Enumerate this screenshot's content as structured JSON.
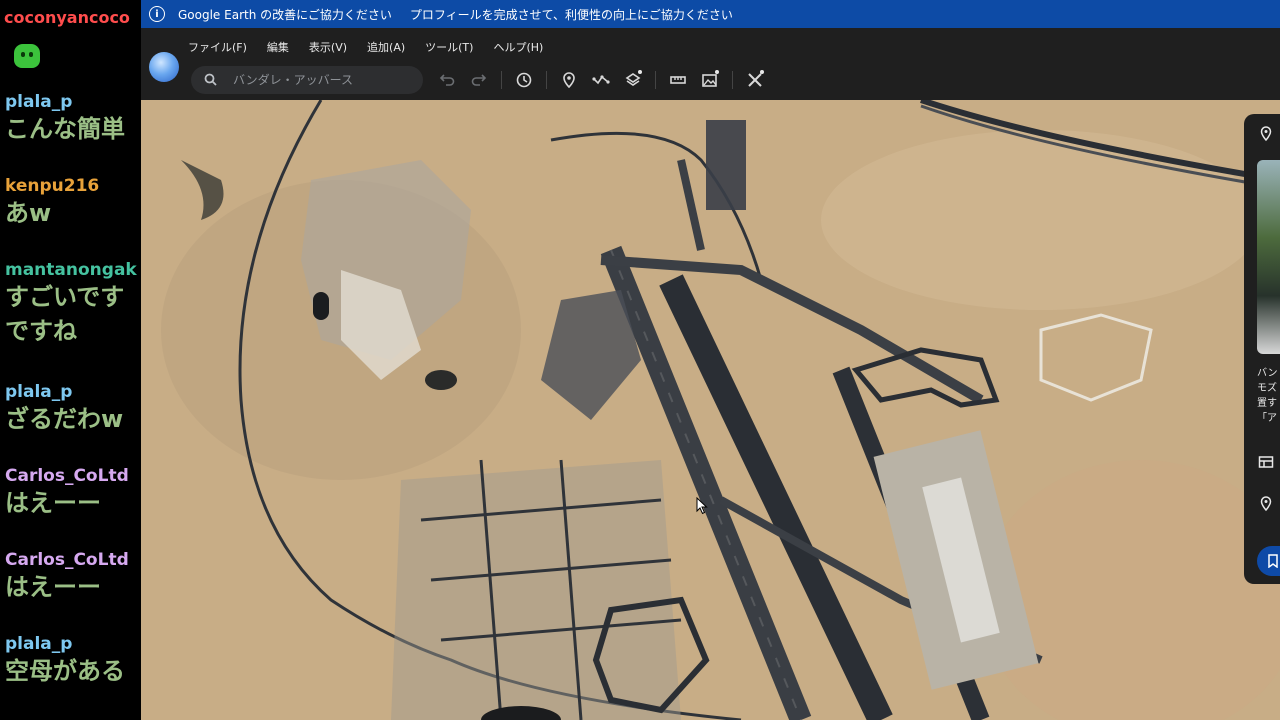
{
  "chat": {
    "top_user": "coconyancoco",
    "messages": [
      {
        "user": "plala_p",
        "text": "こんな簡単",
        "color": "#7ec8f0"
      },
      {
        "user": "kenpu216",
        "text": "あw",
        "color": "#e8a23a"
      },
      {
        "user": "mantanongak",
        "text": "すごいです",
        "text2": "ですね",
        "color": "#45c2a0"
      },
      {
        "user": "plala_p",
        "text": "ざるだわw",
        "color": "#7ec8f0"
      },
      {
        "user": "Carlos_CoLtd",
        "text": "はえーー",
        "color": "#d6a9f0"
      },
      {
        "user": "Carlos_CoLtd",
        "text": "はえーー",
        "color": "#d6a9f0"
      },
      {
        "user": "plala_p",
        "text": "空母がある",
        "color": "#7ec8f0"
      }
    ]
  },
  "banner": {
    "link1": "Google Earth の改善にご協力ください",
    "link2": "プロフィールを完成させて、利便性の向上にご協力ください"
  },
  "menu": [
    "ファイル(F)",
    "編集",
    "表示(V)",
    "追加(A)",
    "ツール(T)",
    "ヘルプ(H)"
  ],
  "search": {
    "placeholder": "バンダレ・アッバース"
  },
  "toolbar": {
    "icons": [
      "undo-icon",
      "redo-icon",
      "historical-imagery-icon",
      "placemark-icon",
      "path-icon",
      "layers-icon",
      "ruler-icon",
      "image-overlay-icon",
      "tools-icon"
    ]
  },
  "right_panel": {
    "text_lines": [
      "バン",
      "モズ",
      "置す",
      "「ア"
    ]
  },
  "colors": {
    "banner": "#0d4ba6",
    "toolbar": "#1f1f1f",
    "desert": "#c9ae88",
    "road": "#2b2f36"
  }
}
